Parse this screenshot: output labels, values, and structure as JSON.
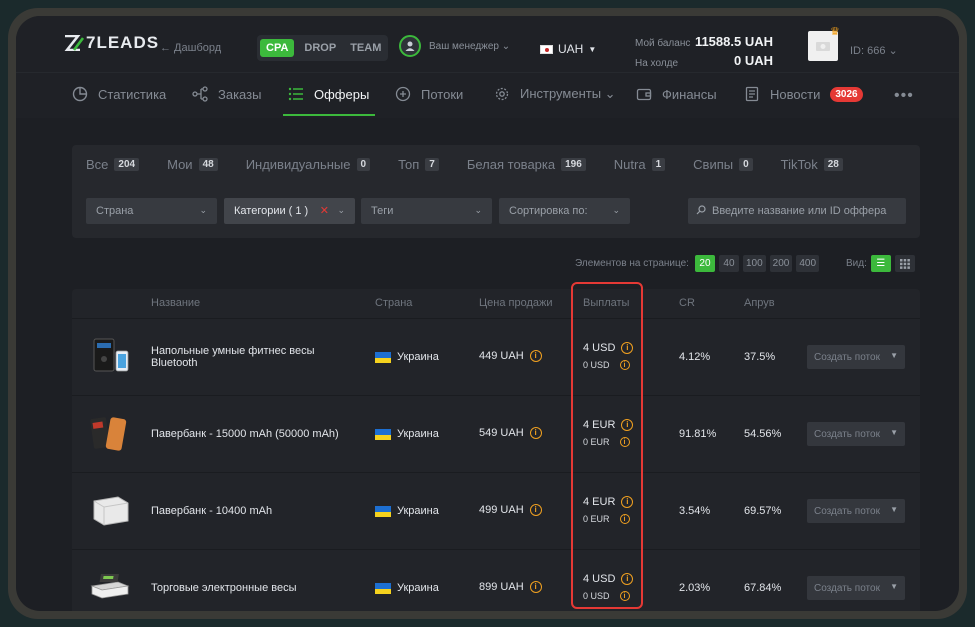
{
  "header": {
    "logo_text": "7LEADS",
    "back_link": "← Дашборд",
    "modes": [
      "CPA",
      "DROP",
      "TEAM"
    ],
    "manager_label": "Ваш менеджер ⌄",
    "currency": "UAH",
    "balance_label": "Мой баланс",
    "hold_label": "На холде",
    "balance_value": "11588.5 UAH",
    "hold_value": "0 UAH",
    "user_id": "ID: 666 ⌄"
  },
  "nav": {
    "items": [
      {
        "label": "Статистика"
      },
      {
        "label": "Заказы"
      },
      {
        "label": "Офферы"
      },
      {
        "label": "Потоки"
      },
      {
        "label": "Инструменты ⌄"
      },
      {
        "label": "Финансы"
      },
      {
        "label": "Новости"
      }
    ],
    "news_badge": "3026",
    "more": "•••"
  },
  "filters": {
    "tabs": [
      {
        "label": "Все",
        "count": "204"
      },
      {
        "label": "Мои",
        "count": "48"
      },
      {
        "label": "Индивидуальные",
        "count": "0"
      },
      {
        "label": "Топ",
        "count": "7"
      },
      {
        "label": "Белая товарка",
        "count": "196"
      },
      {
        "label": "Nutra",
        "count": "1"
      },
      {
        "label": "Свипы",
        "count": "0"
      },
      {
        "label": "TikTok",
        "count": "28"
      }
    ],
    "country": "Страна",
    "categories": "Категории ( 1 )",
    "tags": "Теги",
    "sort": "Сортировка по:",
    "search_placeholder": "Введите название или ID оффера"
  },
  "pagination": {
    "label": "Элементов на странице:",
    "options": [
      "20",
      "40",
      "100",
      "200",
      "400"
    ],
    "view_label": "Вид:"
  },
  "table": {
    "headers": [
      "Название",
      "Страна",
      "Цена продажи",
      "Выплаты",
      "CR",
      "Апрув"
    ],
    "create_label": "Создать поток",
    "rows": [
      {
        "name": "Напольные умные фитнес весы Bluetooth",
        "country": "Украина",
        "price": "449 UAH",
        "payout": "4 USD",
        "payout_sub": "0 USD",
        "cr": "4.12%",
        "approve": "37.5%"
      },
      {
        "name": "Павербанк - 15000 mAh (50000 mAh)",
        "country": "Украина",
        "price": "549 UAH",
        "payout": "4 EUR",
        "payout_sub": "0 EUR",
        "cr": "91.81%",
        "approve": "54.56%"
      },
      {
        "name": "Павербанк - 10400 mAh",
        "country": "Украина",
        "price": "499 UAH",
        "payout": "4 EUR",
        "payout_sub": "0 EUR",
        "cr": "3.54%",
        "approve": "69.57%"
      },
      {
        "name": "Торговые электронные весы",
        "country": "Украина",
        "price": "899 UAH",
        "payout": "4 USD",
        "payout_sub": "0 USD",
        "cr": "2.03%",
        "approve": "67.84%"
      }
    ]
  },
  "colors": {
    "accent": "#3cb93c",
    "badge": "#e53935",
    "info": "#f0a020",
    "highlight": "#e53935"
  }
}
